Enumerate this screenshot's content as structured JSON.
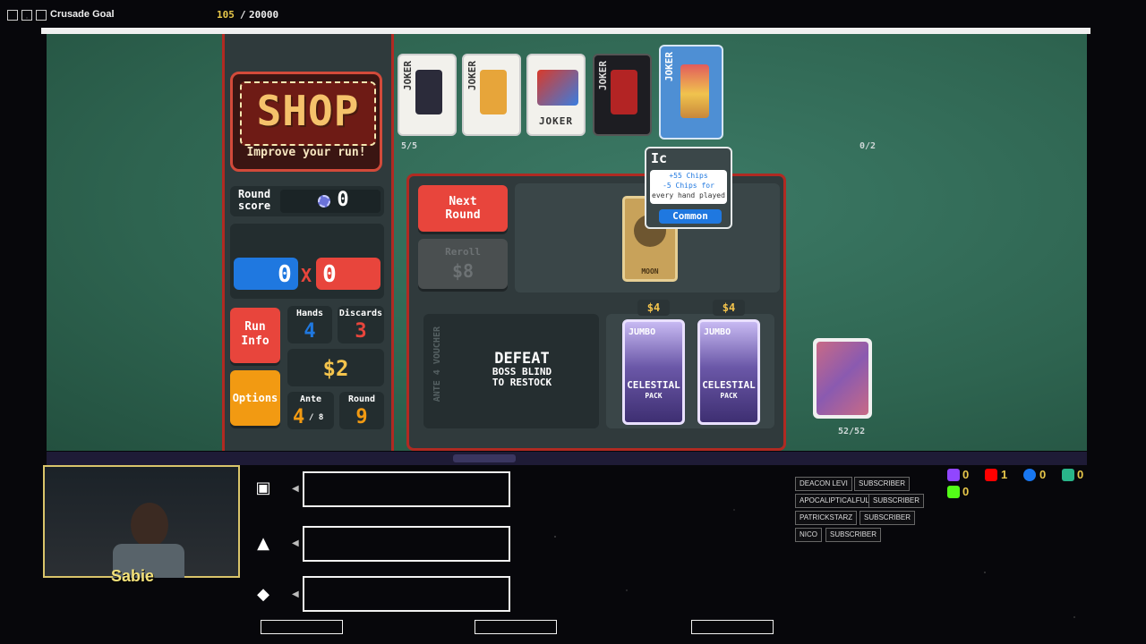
{
  "overlay": {
    "goal_title": "Crusade Goal",
    "goal_current": "105",
    "goal_sep": "/",
    "goal_max": "20000",
    "webcam_name": "Sabie",
    "subscribers": [
      {
        "name": "DEACON LEVI",
        "tag": "SUBSCRIBER"
      },
      {
        "name": "APOCALIPTICALFUL",
        "tag": "SUBSCRIBER"
      },
      {
        "name": "PATRICKSTARZ",
        "tag": "SUBSCRIBER"
      },
      {
        "name": "NICO",
        "tag": "SUBSCRIBER"
      }
    ],
    "socials": {
      "twitch": "0",
      "youtube": "1",
      "facebook": "0",
      "other": "0",
      "kick": "0"
    }
  },
  "game": {
    "shop_title": "SHOP",
    "shop_subtitle": "Improve your run!",
    "round_score_label": "Round\nscore",
    "round_score_value": "0",
    "chips": "0",
    "mult_symbol": "X",
    "mult": "0",
    "run_info_label": "Run\nInfo",
    "options_label": "Options",
    "hands_label": "Hands",
    "hands_value": "4",
    "discards_label": "Discards",
    "discards_value": "3",
    "money": "$2",
    "ante_label": "Ante",
    "ante_value": "4",
    "ante_max": "/ 8",
    "round_label": "Round",
    "round_value": "9",
    "joker_count": "5/5",
    "consumable_count": "0/2",
    "deck_count": "52/52",
    "next_round_label": "Next\nRound",
    "reroll_label": "Reroll",
    "reroll_cost": "$8",
    "voucher_side_text": "ANTE 4 VOUCHER",
    "voucher_msg_1": "DEFEAT",
    "voucher_msg_2": "BOSS BLIND",
    "voucher_msg_3": "TO RESTOCK",
    "joker_word": "JOKER",
    "tarot_name": "MOON",
    "packs": [
      {
        "price": "$4",
        "top": "JUMBO",
        "name": "CELESTIAL",
        "sub": "PACK"
      },
      {
        "price": "$4",
        "top": "JUMBO",
        "name": "CELESTIAL",
        "sub": "PACK"
      }
    ],
    "tooltip": {
      "title": "Ic",
      "line1": "+55 Chips",
      "line2": "-5 Chips for",
      "line3": "every hand played",
      "rarity": "Common"
    }
  },
  "colors": {
    "chips": "#1f78e0",
    "mult": "#e8453c",
    "gold": "#f4c44c",
    "felt": "#2e6450"
  }
}
